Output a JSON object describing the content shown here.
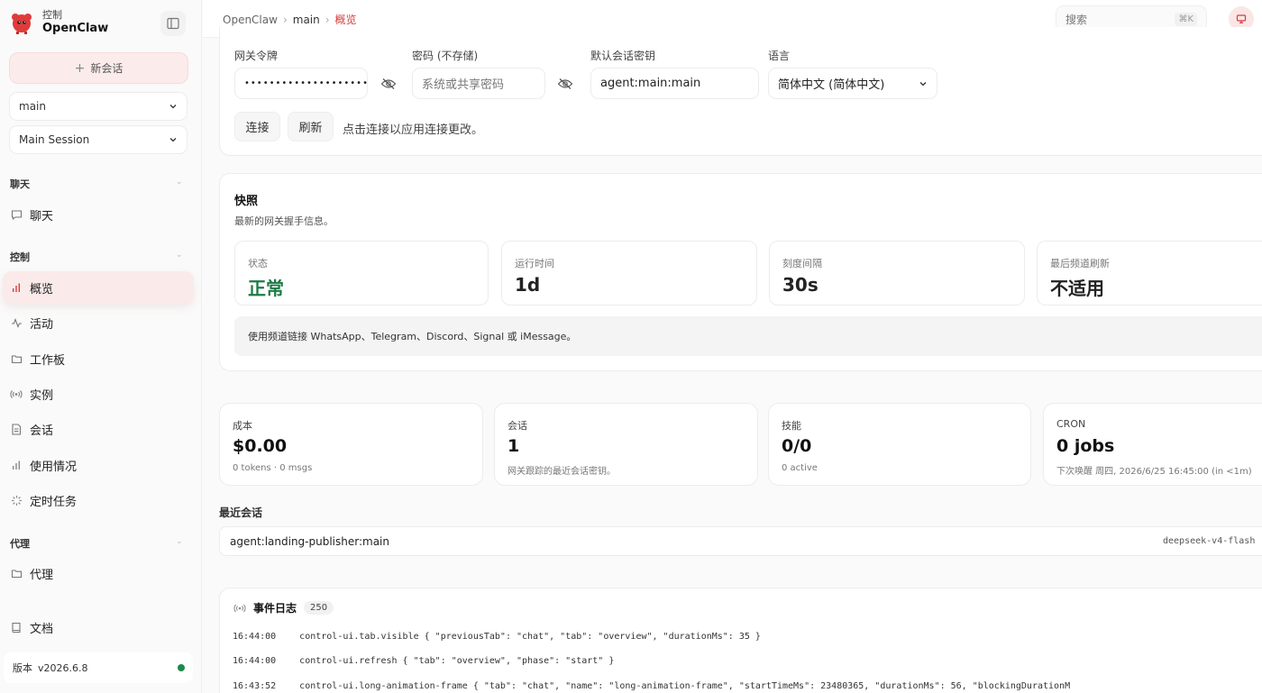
{
  "brand": {
    "small": "控制",
    "name": "OpenClaw"
  },
  "sidebar": {
    "new_session_label": "新会话",
    "agent_select": "main",
    "session_select": "Main Session",
    "sections": [
      {
        "label": "聊天",
        "items": [
          {
            "label": "聊天",
            "icon": "message-icon"
          }
        ]
      },
      {
        "label": "控制",
        "items": [
          {
            "label": "概览",
            "icon": "bar-chart-icon",
            "active": true
          },
          {
            "label": "活动",
            "icon": "activity-icon"
          },
          {
            "label": "工作板",
            "icon": "folder-icon"
          },
          {
            "label": "实例",
            "icon": "broadcast-icon"
          },
          {
            "label": "会话",
            "icon": "document-icon"
          },
          {
            "label": "使用情况",
            "icon": "bar-chart-icon"
          },
          {
            "label": "定时任务",
            "icon": "loader-icon"
          }
        ]
      },
      {
        "label": "代理",
        "items": [
          {
            "label": "代理",
            "icon": "folder-icon"
          }
        ]
      }
    ],
    "docs_label": "文档",
    "version_label": "版本",
    "version_value": "v2026.6.8",
    "status_color": "#1e8a4a"
  },
  "topbar": {
    "breadcrumbs": [
      "OpenClaw",
      "main",
      "概览"
    ],
    "search_placeholder": "搜索",
    "search_shortcut": "⌘K"
  },
  "connection": {
    "token_label": "网关令牌",
    "token_value": "••••••••••••••••••••••••••••••••",
    "password_label": "密码 (不存储)",
    "password_placeholder": "系统或共享密码",
    "session_key_label": "默认会话密钥",
    "session_key_value": "agent:main:main",
    "language_label": "语言",
    "language_value": "简体中文 (简体中文)",
    "connect_label": "连接",
    "refresh_label": "刷新",
    "hint": "点击连接以应用连接更改。"
  },
  "snapshot": {
    "title": "快照",
    "subtitle": "最新的网关握手信息。",
    "stats": [
      {
        "label": "状态",
        "value": "正常",
        "color": "#1e7a45"
      },
      {
        "label": "运行时间",
        "value": "1d"
      },
      {
        "label": "刻度间隔",
        "value": "30s"
      },
      {
        "label": "最后频道刷新",
        "value": "不适用"
      }
    ],
    "notice": "使用频道链接 WhatsApp、Telegram、Discord、Signal 或 iMessage。"
  },
  "metrics": [
    {
      "label": "成本",
      "value": "$0.00",
      "sub": "0 tokens · 0 msgs"
    },
    {
      "label": "会话",
      "value": "1",
      "sub": "网关跟踪的最近会话密钥。"
    },
    {
      "label": "技能",
      "value": "0/0",
      "sub": "0 active"
    },
    {
      "label": "CRON",
      "value": "0 jobs",
      "sub": "下次唤醒 周四, 2026/6/25 16:45:00 (in <1m)"
    }
  ],
  "recent": {
    "title": "最近会话",
    "rows": [
      {
        "key": "agent:landing-publisher:main",
        "model": "deepseek-v4-flash"
      }
    ]
  },
  "events": {
    "title": "事件日志",
    "count": "250",
    "rows": [
      {
        "time": "16:44:00",
        "text": "control-ui.tab.visible  { \"previousTab\": \"chat\", \"tab\": \"overview\", \"durationMs\": 35 }"
      },
      {
        "time": "16:44:00",
        "text": "control-ui.refresh  { \"tab\": \"overview\", \"phase\": \"start\" }"
      },
      {
        "time": "16:43:52",
        "text": "control-ui.long-animation-frame  { \"tab\": \"chat\", \"name\": \"long-animation-frame\", \"startTimeMs\": 23480365, \"durationMs\": 56, \"blockingDurationM"
      }
    ]
  }
}
